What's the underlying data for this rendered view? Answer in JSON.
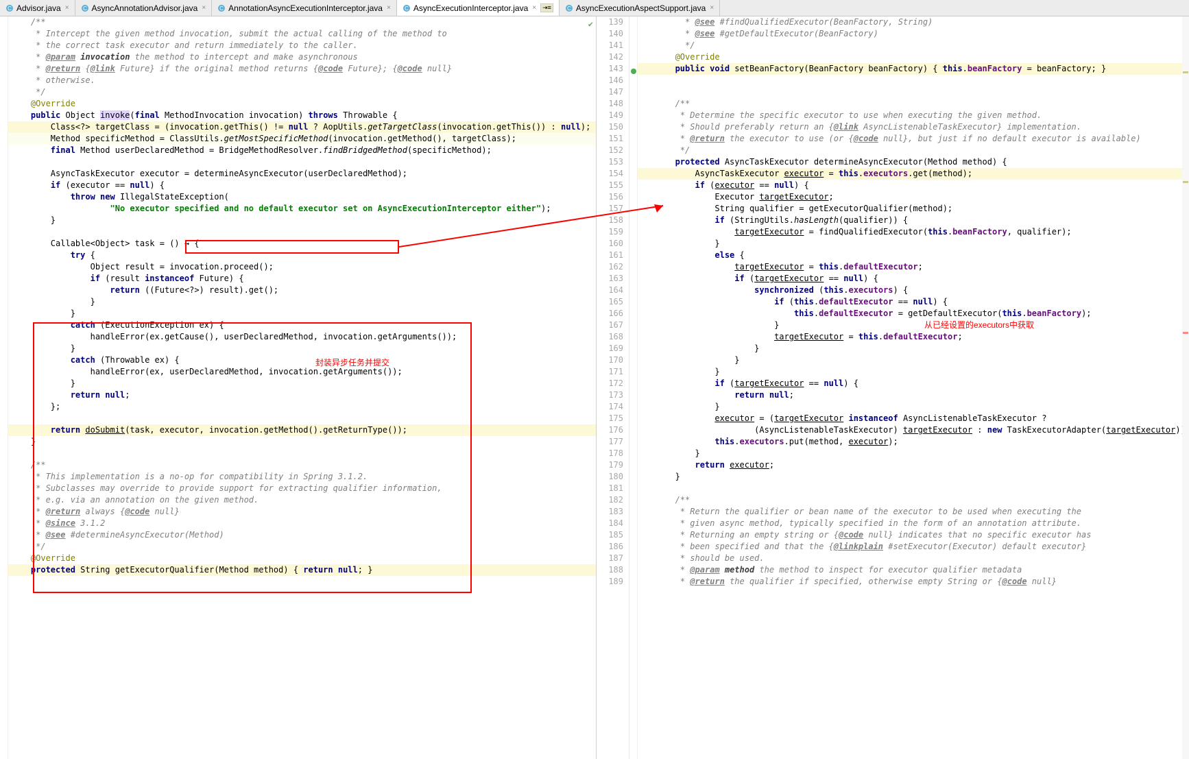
{
  "tabs": [
    {
      "label": "Advisor.java",
      "active": false
    },
    {
      "label": "AsyncAnnotationAdvisor.java",
      "active": false
    },
    {
      "label": "AnnotationAsyncExecutionInterceptor.java",
      "active": false
    },
    {
      "label": "AsyncExecutionInterceptor.java",
      "active": true,
      "pinned": true
    },
    {
      "label": "AsyncExecutionAspectSupport.java",
      "active": false
    }
  ],
  "annotations": {
    "left_red": "封装异步任务并提交",
    "right_red": "从已经设置的executors中获取"
  },
  "left_lines": [
    {
      "cls": "",
      "html": "    <span class='c'>/**</span>"
    },
    {
      "cls": "",
      "html": "    <span class='c'> * Intercept the given method invocation, submit the actual calling of the method to</span>"
    },
    {
      "cls": "",
      "html": "    <span class='c'> * the correct task executor and return immediately to the caller.</span>"
    },
    {
      "cls": "",
      "html": "    <span class='c'> * <span class='ct'>@param</span> <span style='font-weight:bold;color:#3d3d3d'>invocation</span> the method to intercept and make asynchronous</span>"
    },
    {
      "cls": "",
      "html": "    <span class='c'> * <span class='ct'>@return</span> {<span class='ct'>@link</span> Future} if the original method returns {<span class='ct'>@code</span> Future}; {<span class='ct'>@code</span> null}</span>"
    },
    {
      "cls": "",
      "html": "    <span class='c'> * otherwise.</span>"
    },
    {
      "cls": "",
      "html": "    <span class='c'> */</span>"
    },
    {
      "cls": "",
      "html": "    <span class='ann'>@Override</span>"
    },
    {
      "cls": "",
      "html": "    <span class='k'>public</span> Object <span class='hl'>invoke</span>(<span class='k'>final</span> MethodInvocation invocation) <span class='k'>throws</span> Throwable {"
    },
    {
      "cls": "strip",
      "html": "        Class&lt;?&gt; targetClass = (invocation.getThis() != <span class='k'>null</span> ? AopUtils.<span class='m'>getTargetClass</span>(invocation.getThis()) : <span class='k'>null</span>);"
    },
    {
      "cls": "strip2",
      "html": "        Method specificMethod = ClassUtils.<span class='m'>getMostSpecificMethod</span>(invocation.getMethod(), targetClass);"
    },
    {
      "cls": "",
      "html": "        <span class='k'>final</span> Method userDeclaredMethod = BridgeMethodResolver.<span class='m'>findBridgedMethod</span>(specificMethod);"
    },
    {
      "cls": "",
      "html": ""
    },
    {
      "cls": "",
      "html": "        AsyncTaskExecutor executor = determineAsyncExecutor(userDeclaredMethod);"
    },
    {
      "cls": "",
      "html": "        <span class='k'>if</span> (executor == <span class='k'>null</span>) {"
    },
    {
      "cls": "",
      "html": "            <span class='k'>throw new</span> IllegalStateException("
    },
    {
      "cls": "",
      "html": "                    <span class='s'>\"No executor specified and no default executor set on AsyncExecutionInterceptor either\"</span>);"
    },
    {
      "cls": "",
      "html": "        }"
    },
    {
      "cls": "",
      "html": ""
    },
    {
      "cls": "",
      "html": "        Callable&lt;Object&gt; task = () → {"
    },
    {
      "cls": "",
      "html": "            <span class='k'>try</span> {"
    },
    {
      "cls": "",
      "html": "                Object result = invocation.proceed();"
    },
    {
      "cls": "",
      "html": "                <span class='k'>if</span> (result <span class='k'>instanceof</span> Future) {"
    },
    {
      "cls": "",
      "html": "                    <span class='k'>return</span> ((Future&lt;?&gt;) result).get();"
    },
    {
      "cls": "",
      "html": "                }"
    },
    {
      "cls": "",
      "html": "            }"
    },
    {
      "cls": "",
      "html": "            <span class='k'>catch</span> (ExecutionException ex) {"
    },
    {
      "cls": "",
      "html": "                handleError(ex.getCause(), userDeclaredMethod, invocation.getArguments());"
    },
    {
      "cls": "",
      "html": "            }"
    },
    {
      "cls": "",
      "html": "            <span class='k'>catch</span> (Throwable ex) {"
    },
    {
      "cls": "",
      "html": "                handleError(ex, userDeclaredMethod, invocation.getArguments());"
    },
    {
      "cls": "",
      "html": "            }"
    },
    {
      "cls": "",
      "html": "            <span class='k'>return null</span>;"
    },
    {
      "cls": "",
      "html": "        };"
    },
    {
      "cls": "",
      "html": ""
    },
    {
      "cls": "strip",
      "html": "        <span class='k'>return</span> <span class='u'>doSubmit</span>(task, executor, invocation.getMethod().getReturnType());"
    },
    {
      "cls": "",
      "html": "    }"
    },
    {
      "cls": "",
      "html": ""
    },
    {
      "cls": "",
      "html": "    <span class='c'>/**</span>"
    },
    {
      "cls": "",
      "html": "    <span class='c'> * This implementation is a no-op for compatibility in Spring 3.1.2.</span>"
    },
    {
      "cls": "",
      "html": "    <span class='c'> * Subclasses may override to provide support for extracting qualifier information,</span>"
    },
    {
      "cls": "",
      "html": "    <span class='c'> * e.g. via an annotation on the given method.</span>"
    },
    {
      "cls": "",
      "html": "    <span class='c'> * <span class='ct'>@return</span> always {<span class='ct'>@code</span> null}</span>"
    },
    {
      "cls": "",
      "html": "    <span class='c'> * <span class='ct'>@since</span> 3.1.2</span>"
    },
    {
      "cls": "",
      "html": "    <span class='c'> * <span class='ct'>@see</span> #determineAsyncExecutor(Method)</span>"
    },
    {
      "cls": "",
      "html": "    <span class='c'> */</span>"
    },
    {
      "cls": "",
      "html": "    <span class='ann'>@Override</span>"
    },
    {
      "cls": "strip",
      "html": "    <span class='k'>protected</span> String getExecutorQualifier(Method method) { <span class='k'>return null</span>; }"
    }
  ],
  "right_start": 139,
  "right_lines": [
    {
      "cls": "",
      "html": "        <span class='c'> * <span class='ct'>@see</span> #findQualifiedExecutor(BeanFactory, String)</span>"
    },
    {
      "cls": "",
      "html": "        <span class='c'> * <span class='ct'>@see</span> #getDefaultExecutor(BeanFactory)</span>"
    },
    {
      "cls": "",
      "html": "        <span class='c'> */</span>"
    },
    {
      "cls": "",
      "html": "       <span class='ann'>@Override</span>"
    },
    {
      "cls": "strip",
      "html": "       <span class='k'>public void</span> setBeanFactory(BeanFactory beanFactory) { <span class='k'>this</span>.<span class='b'>beanFactory</span> = beanFactory; }"
    },
    {
      "cls": "",
      "html": ""
    },
    {
      "cls": "",
      "html": ""
    },
    {
      "cls": "",
      "html": "       <span class='c'>/**</span>"
    },
    {
      "cls": "",
      "html": "       <span class='c'> * Determine the specific executor to use when executing the given method.</span>"
    },
    {
      "cls": "",
      "html": "       <span class='c'> * Should preferably return an {<span class='ct'>@link</span> AsyncListenableTaskExecutor} implementation.</span>"
    },
    {
      "cls": "",
      "html": "       <span class='c'> * <span class='ct'>@return</span> the executor to use (or {<span class='ct'>@code</span> null}, but just if no default executor is available)</span>"
    },
    {
      "cls": "",
      "html": "       <span class='c'> */</span>"
    },
    {
      "cls": "",
      "html": "       <span class='k'>protected</span> AsyncTaskExecutor determineAsyncExecutor(Method method) {"
    },
    {
      "cls": "strip",
      "html": "           AsyncTaskExecutor <span class='u'>executor</span> = <span class='k'>this</span>.<span class='b'>executors</span>.get(method);"
    },
    {
      "cls": "",
      "html": "           <span class='k'>if</span> (<span class='u'>executor</span> == <span class='k'>null</span>) {"
    },
    {
      "cls": "",
      "html": "               Executor <span class='u'>targetExecutor</span>;"
    },
    {
      "cls": "",
      "html": "               String qualifier = getExecutorQualifier(method);"
    },
    {
      "cls": "",
      "html": "               <span class='k'>if</span> (StringUtils.<span class='m'>hasLength</span>(qualifier)) {"
    },
    {
      "cls": "",
      "html": "                   <span class='u'>targetExecutor</span> = findQualifiedExecutor(<span class='k'>this</span>.<span class='b'>beanFactory</span>, qualifier);"
    },
    {
      "cls": "",
      "html": "               }"
    },
    {
      "cls": "",
      "html": "               <span class='k'>else</span> {"
    },
    {
      "cls": "",
      "html": "                   <span class='u'>targetExecutor</span> = <span class='k'>this</span>.<span class='b'>defaultExecutor</span>;"
    },
    {
      "cls": "",
      "html": "                   <span class='k'>if</span> (<span class='u'>targetExecutor</span> == <span class='k'>null</span>) {"
    },
    {
      "cls": "",
      "html": "                       <span class='k'>synchronized</span> (<span class='k'>this</span>.<span class='b'>executors</span>) {"
    },
    {
      "cls": "",
      "html": "                           <span class='k'>if</span> (<span class='k'>this</span>.<span class='b'>defaultExecutor</span> == <span class='k'>null</span>) {"
    },
    {
      "cls": "",
      "html": "                               <span class='k'>this</span>.<span class='b'>defaultExecutor</span> = getDefaultExecutor(<span class='k'>this</span>.<span class='b'>beanFactory</span>);"
    },
    {
      "cls": "",
      "html": "                           }"
    },
    {
      "cls": "",
      "html": "                           <span class='u'>targetExecutor</span> = <span class='k'>this</span>.<span class='b'>defaultExecutor</span>;"
    },
    {
      "cls": "",
      "html": "                       }"
    },
    {
      "cls": "",
      "html": "                   }"
    },
    {
      "cls": "",
      "html": "               }"
    },
    {
      "cls": "",
      "html": "               <span class='k'>if</span> (<span class='u'>targetExecutor</span> == <span class='k'>null</span>) {"
    },
    {
      "cls": "",
      "html": "                   <span class='k'>return null</span>;"
    },
    {
      "cls": "",
      "html": "               }"
    },
    {
      "cls": "",
      "html": "               <span class='u'>executor</span> = (<span class='u'>targetExecutor</span> <span class='k'>instanceof</span> AsyncListenableTaskExecutor ?"
    },
    {
      "cls": "",
      "html": "                       (AsyncListenableTaskExecutor) <span class='u'>targetExecutor</span> : <span class='k'>new</span> TaskExecutorAdapter(<span class='u'>targetExecutor</span>));"
    },
    {
      "cls": "",
      "html": "               <span class='k'>this</span>.<span class='b'>executors</span>.put(method, <span class='u'>executor</span>);"
    },
    {
      "cls": "",
      "html": "           }"
    },
    {
      "cls": "",
      "html": "           <span class='k'>return</span> <span class='u'>executor</span>;"
    },
    {
      "cls": "",
      "html": "       }"
    },
    {
      "cls": "",
      "html": ""
    },
    {
      "cls": "",
      "html": "       <span class='c'>/**</span>"
    },
    {
      "cls": "",
      "html": "       <span class='c'> * Return the qualifier or bean name of the executor to be used when executing the</span>"
    },
    {
      "cls": "",
      "html": "       <span class='c'> * given async method, typically specified in the form of an annotation attribute.</span>"
    },
    {
      "cls": "",
      "html": "       <span class='c'> * Returning an empty string or {<span class='ct'>@code</span> null} indicates that no specific executor has</span>"
    },
    {
      "cls": "",
      "html": "       <span class='c'> * been specified and that the {<span class='ct'>@linkplain</span> #setExecutor(Executor) default executor}</span>"
    },
    {
      "cls": "",
      "html": "       <span class='c'> * should be used.</span>"
    },
    {
      "cls": "",
      "html": "       <span class='c'> * <span class='ct'>@param</span> <span style='font-weight:bold;color:#3d3d3d'>method</span> the method to inspect for executor qualifier metadata</span>"
    },
    {
      "cls": "",
      "html": "       <span class='c'> * <span class='ct'>@return</span> the qualifier if specified, otherwise empty String or {<span class='ct'>@code</span> null}</span>"
    }
  ]
}
